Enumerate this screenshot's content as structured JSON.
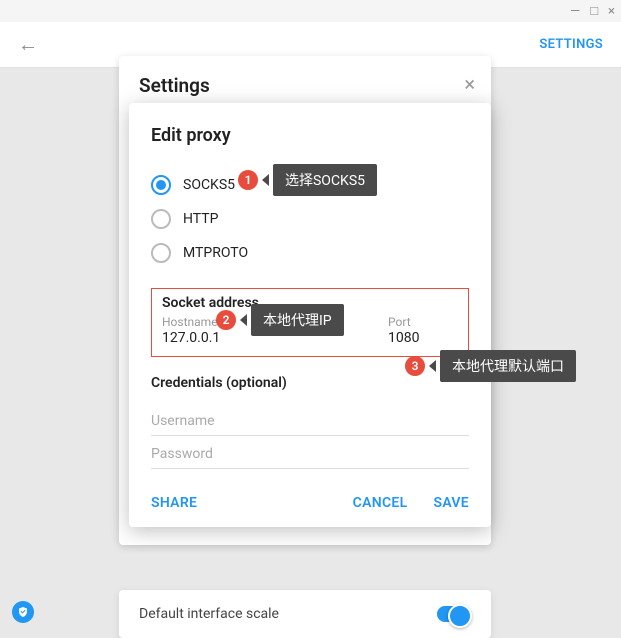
{
  "window": {
    "minimize": "—",
    "maximize": "□",
    "close": "×"
  },
  "topbar": {
    "settings": "SETTINGS"
  },
  "bg_panel": {
    "title": "Settings"
  },
  "bg_bottom": {
    "label": "Default interface scale"
  },
  "modal": {
    "title": "Edit proxy",
    "radios": {
      "socks5": "SOCKS5",
      "http": "HTTP",
      "mtproto": "MTPROTO"
    },
    "socket": {
      "section": "Socket address",
      "hostname_label": "Hostname",
      "hostname_value": "127.0.0.1",
      "port_label": "Port",
      "port_value": "1080"
    },
    "creds": {
      "section": "Credentials (optional)",
      "username_ph": "Username",
      "password_ph": "Password"
    },
    "actions": {
      "share": "SHARE",
      "cancel": "CANCEL",
      "save": "SAVE"
    }
  },
  "callouts": {
    "c1": {
      "num": "1",
      "text": "选择SOCKS5"
    },
    "c2": {
      "num": "2",
      "text": "本地代理IP"
    },
    "c3": {
      "num": "3",
      "text": "本地代理默认端口"
    }
  }
}
